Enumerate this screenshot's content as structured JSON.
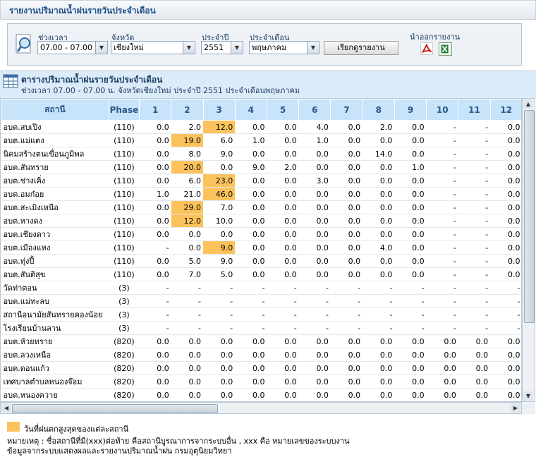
{
  "page_title": "รายงานปริมาณน้ำฝนรายวันประจำเดือน",
  "filters": {
    "time_label": "ช่วงเวลา",
    "time_value": "07.00 - 07.00",
    "province_label": "จังหวัด",
    "province_value": "เชียงใหม่",
    "year_label": "ประจำปี",
    "year_value": "2551",
    "month_label": "ประจำเดือน",
    "month_value": "พฤษภาคม",
    "report_button": "เรียกดูรายงาน",
    "export_label": "นำออกรายงาน"
  },
  "table_title": "ตารางปริมาณน้ำฝนรายวันประจำเดือน",
  "table_subtitle": "ช่วงเวลา 07.00 - 07.00 น. จังหวัดเชียงใหม่ ประจำปี 2551 ประจำเดือนพฤษภาคม",
  "columns": [
    "สถานี",
    "Phase",
    "1",
    "2",
    "3",
    "4",
    "5",
    "6",
    "7",
    "8",
    "9",
    "10",
    "11",
    "12"
  ],
  "highlight_color": "#fcc35c",
  "rows": [
    {
      "station": "อบต.สบเปิง",
      "phase": "(110)",
      "values": [
        "0.0",
        "2.0",
        "12.0",
        "0.0",
        "0.0",
        "4.0",
        "0.0",
        "2.0",
        "0.0",
        "-",
        "-",
        "0.0"
      ],
      "max_index": 2
    },
    {
      "station": "อบต.แม่แตง",
      "phase": "(110)",
      "values": [
        "0.0",
        "19.0",
        "6.0",
        "1.0",
        "0.0",
        "1.0",
        "0.0",
        "0.0",
        "0.0",
        "-",
        "-",
        "0.0"
      ],
      "max_index": 1
    },
    {
      "station": "นิคมสร้างตนเขื่อนภูมิพล",
      "phase": "(110)",
      "values": [
        "0.0",
        "8.0",
        "9.0",
        "0.0",
        "0.0",
        "0.0",
        "0.0",
        "14.0",
        "0.0",
        "-",
        "-",
        "0.0"
      ],
      "max_index": -1
    },
    {
      "station": "อบต.สันทราย",
      "phase": "(110)",
      "values": [
        "0.0",
        "20.0",
        "0.0",
        "9.0",
        "2.0",
        "0.0",
        "0.0",
        "0.0",
        "1.0",
        "-",
        "-",
        "0.0"
      ],
      "max_index": 1
    },
    {
      "station": "อบต.ช่างเคิ่ง",
      "phase": "(110)",
      "values": [
        "0.0",
        "6.0",
        "23.0",
        "0.0",
        "0.0",
        "3.0",
        "0.0",
        "0.0",
        "0.0",
        "-",
        "-",
        "0.0"
      ],
      "max_index": 2
    },
    {
      "station": "อบต.อมก๋อย",
      "phase": "(110)",
      "values": [
        "1.0",
        "21.0",
        "46.0",
        "0.0",
        "0.0",
        "0.0",
        "0.0",
        "0.0",
        "0.0",
        "-",
        "-",
        "0.0"
      ],
      "max_index": 2
    },
    {
      "station": "อบต.สะเมิงเหนือ",
      "phase": "(110)",
      "values": [
        "0.0",
        "29.0",
        "7.0",
        "0.0",
        "0.0",
        "0.0",
        "0.0",
        "0.0",
        "0.0",
        "-",
        "-",
        "0.0"
      ],
      "max_index": 1
    },
    {
      "station": "อบต.หางดง",
      "phase": "(110)",
      "values": [
        "0.0",
        "12.0",
        "10.0",
        "0.0",
        "0.0",
        "0.0",
        "0.0",
        "0.0",
        "0.0",
        "-",
        "-",
        "0.0"
      ],
      "max_index": 1
    },
    {
      "station": "อบต.เชียงดาว",
      "phase": "(110)",
      "values": [
        "0.0",
        "0.0",
        "0.0",
        "0.0",
        "0.0",
        "0.0",
        "0.0",
        "0.0",
        "0.0",
        "-",
        "-",
        "0.0"
      ],
      "max_index": -1
    },
    {
      "station": "อบต.เมืองแหง",
      "phase": "(110)",
      "values": [
        "-",
        "0.0",
        "9.0",
        "0.0",
        "0.0",
        "0.0",
        "0.0",
        "4.0",
        "0.0",
        "-",
        "-",
        "0.0"
      ],
      "max_index": 2
    },
    {
      "station": "อบต.ทุ่งปี้",
      "phase": "(110)",
      "values": [
        "0.0",
        "5.0",
        "9.0",
        "0.0",
        "0.0",
        "0.0",
        "0.0",
        "0.0",
        "0.0",
        "-",
        "-",
        "0.0"
      ],
      "max_index": -1
    },
    {
      "station": "อบต.สันติสุข",
      "phase": "(110)",
      "values": [
        "0.0",
        "7.0",
        "5.0",
        "0.0",
        "0.0",
        "0.0",
        "0.0",
        "0.0",
        "0.0",
        "-",
        "-",
        "0.0"
      ],
      "max_index": -1
    },
    {
      "station": "วัดท่าตอน",
      "phase": "(3)",
      "values": [
        "-",
        "-",
        "-",
        "-",
        "-",
        "-",
        "-",
        "-",
        "-",
        "-",
        "-",
        "-"
      ],
      "max_index": -1
    },
    {
      "station": "อบต.แม่ทะลบ",
      "phase": "(3)",
      "values": [
        "-",
        "-",
        "-",
        "-",
        "-",
        "-",
        "-",
        "-",
        "-",
        "-",
        "-",
        "-"
      ],
      "max_index": -1
    },
    {
      "station": "สถานีอนามัยสันทรายคองน้อย",
      "phase": "(3)",
      "values": [
        "-",
        "-",
        "-",
        "-",
        "-",
        "-",
        "-",
        "-",
        "-",
        "-",
        "-",
        "-"
      ],
      "max_index": -1
    },
    {
      "station": "โรงเรียนบ้านลาน",
      "phase": "(3)",
      "values": [
        "-",
        "-",
        "-",
        "-",
        "-",
        "-",
        "-",
        "-",
        "-",
        "-",
        "-",
        "-"
      ],
      "max_index": -1
    },
    {
      "station": "อบต.ห้วยทราย",
      "phase": "(820)",
      "values": [
        "0.0",
        "0.0",
        "0.0",
        "0.0",
        "0.0",
        "0.0",
        "0.0",
        "0.0",
        "0.0",
        "0.0",
        "0.0",
        "0.0"
      ],
      "max_index": -1
    },
    {
      "station": "อบต.ลวงเหนือ",
      "phase": "(820)",
      "values": [
        "0.0",
        "0.0",
        "0.0",
        "0.0",
        "0.0",
        "0.0",
        "0.0",
        "0.0",
        "0.0",
        "0.0",
        "0.0",
        "0.0"
      ],
      "max_index": -1
    },
    {
      "station": "อบต.ดอนแก้ว",
      "phase": "(820)",
      "values": [
        "0.0",
        "0.0",
        "0.0",
        "0.0",
        "0.0",
        "0.0",
        "0.0",
        "0.0",
        "0.0",
        "0.0",
        "0.0",
        "0.0"
      ],
      "max_index": -1
    },
    {
      "station": "เทศบาลตำบลหนองจ๊อม",
      "phase": "(820)",
      "values": [
        "0.0",
        "0.0",
        "0.0",
        "0.0",
        "0.0",
        "0.0",
        "0.0",
        "0.0",
        "0.0",
        "0.0",
        "0.0",
        "0.0"
      ],
      "max_index": -1
    },
    {
      "station": "อบต.หนองควาย",
      "phase": "(820)",
      "values": [
        "0.0",
        "0.0",
        "0.0",
        "0.0",
        "0.0",
        "0.0",
        "0.0",
        "0.0",
        "0.0",
        "0.0",
        "0.0",
        "0.0"
      ],
      "max_index": -1
    }
  ],
  "legend_text": "วันที่ฝนตกสูงสุดของแต่ละสถานี",
  "note_line1": "หมายเหตุ : ชื่อสถานีที่มี(xxx)ต่อท้าย คือสถานีบูรณาการจากระบบอื่น , xxx คือ หมายเลขของระบบงาน",
  "note_line2": "ข้อมูลจากระบบแสดงผลและรายงานปริมาณน้ำฝน กรมอุตุนิยมวิทยา"
}
